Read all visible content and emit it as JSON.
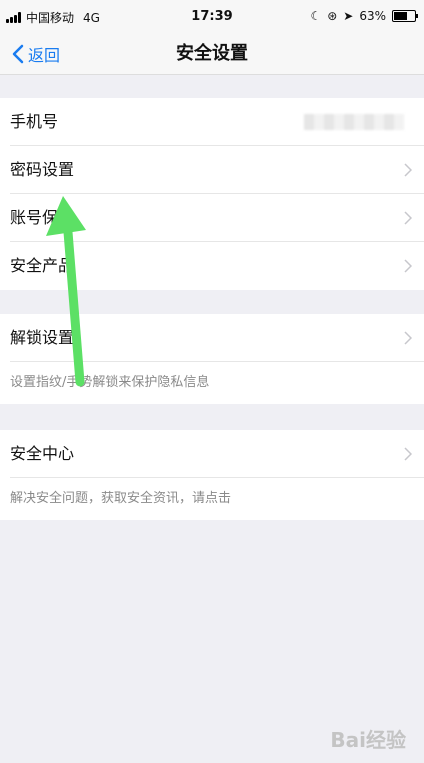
{
  "status_bar": {
    "carrier": "中国移动",
    "network": "4G",
    "time": "17:39",
    "battery": "63%",
    "battery_level": 0.63
  },
  "nav": {
    "back_label": "返回",
    "title": "安全设置"
  },
  "group1": [
    {
      "label": "手机号"
    },
    {
      "label": "密码设置"
    },
    {
      "label": "账号保"
    },
    {
      "label": "安全产品"
    }
  ],
  "group2": {
    "label": "解锁设置",
    "hint": "设置指纹/手势解锁来保护隐私信息"
  },
  "group3": {
    "label": "安全中心",
    "hint": "解决安全问题，获取安全资讯，请点击"
  },
  "watermark": "Bai经验",
  "colors": {
    "accent": "#1a7cf0",
    "background": "#efeff4",
    "annotation_arrow": "#5ce065"
  }
}
